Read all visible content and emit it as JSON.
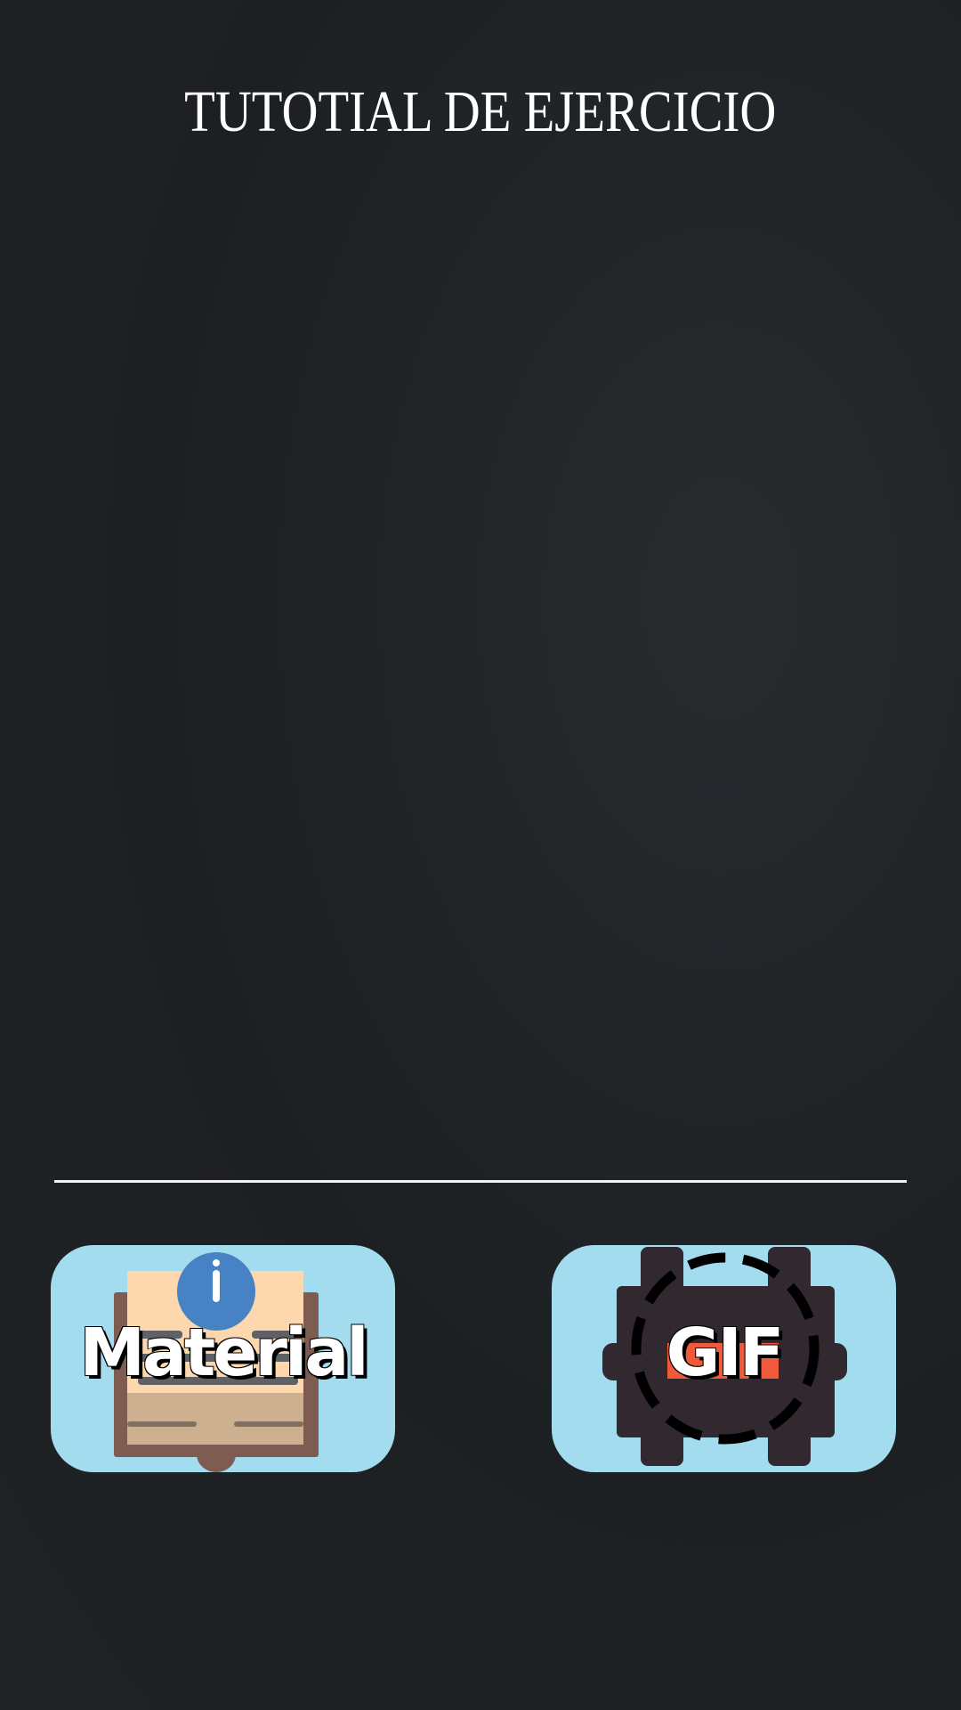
{
  "header": {
    "title": "TUTOTIAL DE EJERCICIO"
  },
  "buttons": [
    {
      "label": "Material",
      "icon": "book-info-icon"
    },
    {
      "label": "GIF",
      "icon": "gif-film-icon"
    }
  ],
  "colors": {
    "background": "#1f2225",
    "button_bg": "#a4dcef",
    "info_blue": "#4682c4",
    "gif_red": "#f05a3a"
  }
}
